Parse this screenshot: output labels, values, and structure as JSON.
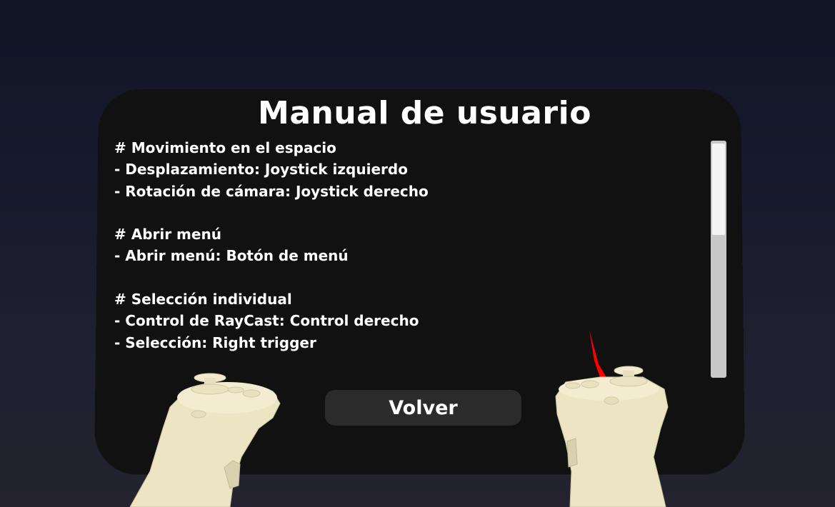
{
  "panel": {
    "title": "Manual de usuario",
    "lines": [
      "# Movimiento en el espacio",
      "- Desplazamiento: Joystick izquierdo",
      "- Rotación de cámara: Joystick derecho",
      "",
      "# Abrir menú",
      "- Abrir menú: Botón de menú",
      "",
      "# Selección individual",
      "- Control de RayCast: Control derecho",
      "- Selección: Right trigger"
    ],
    "back_button_label": "Volver"
  },
  "scene": {
    "controllers": [
      "left-controller",
      "right-controller"
    ],
    "pointer_color": "#ff0000",
    "controller_color": "#ece4c2"
  }
}
